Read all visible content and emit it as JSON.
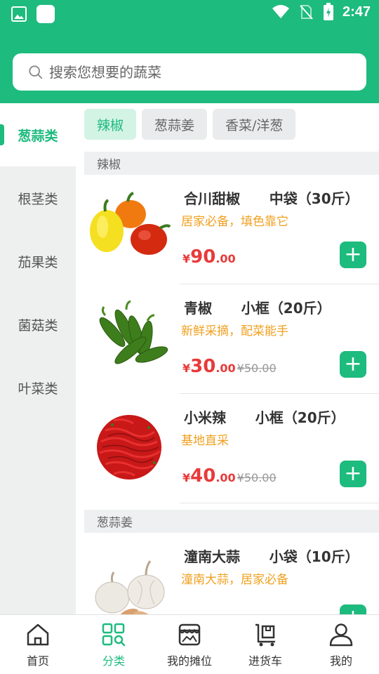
{
  "status_bar": {
    "time": "2:47"
  },
  "search": {
    "placeholder": "搜索您想要的蔬菜"
  },
  "sidebar": {
    "items": [
      {
        "label": "葱蒜类",
        "active": true
      },
      {
        "label": "根茎类",
        "active": false
      },
      {
        "label": "茄果类",
        "active": false
      },
      {
        "label": "菌菇类",
        "active": false
      },
      {
        "label": "叶菜类",
        "active": false
      }
    ]
  },
  "chips": [
    {
      "label": "辣椒",
      "active": true
    },
    {
      "label": "葱蒜姜",
      "active": false
    },
    {
      "label": "香菜/洋葱",
      "active": false
    }
  ],
  "sections": [
    {
      "header": "辣椒",
      "products": [
        {
          "title": "合川甜椒      中袋（30斤）",
          "desc": "居家必备，填色靠它",
          "currency": "¥",
          "price_int": "90",
          "price_dec": ".00",
          "old_price": "",
          "image": "bell-peppers-image"
        },
        {
          "title": "青椒      小框（20斤）",
          "desc": "新鲜采摘，配菜能手",
          "currency": "¥",
          "price_int": "30",
          "price_dec": ".00",
          "old_price": "¥50.00",
          "image": "green-chili-image"
        },
        {
          "title": "小米辣      小框（20斤）",
          "desc": "基地直采",
          "currency": "¥",
          "price_int": "40",
          "price_dec": ".00",
          "old_price": "¥50.00",
          "image": "red-chili-image"
        }
      ]
    },
    {
      "header": "葱蒜姜",
      "products": [
        {
          "title": "潼南大蒜      小袋（10斤）",
          "desc": "潼南大蒜，居家必备",
          "currency": "¥",
          "price_int": "",
          "price_dec": "",
          "old_price": "",
          "image": "garlic-image"
        }
      ]
    }
  ],
  "bottom_nav": [
    {
      "label": "首页",
      "icon": "home-icon",
      "active": false
    },
    {
      "label": "分类",
      "icon": "category-icon",
      "active": true
    },
    {
      "label": "我的摊位",
      "icon": "stall-icon",
      "active": false
    },
    {
      "label": "进货车",
      "icon": "cart-icon",
      "active": false
    },
    {
      "label": "我的",
      "icon": "profile-icon",
      "active": false
    }
  ],
  "colors": {
    "primary": "#1dbb7e",
    "price": "#e83a3a",
    "desc": "#f0a020"
  }
}
